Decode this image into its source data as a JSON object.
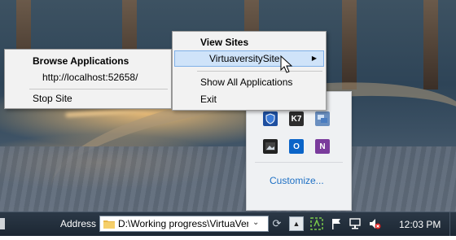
{
  "system_menu": {
    "items": [
      {
        "label": "View Sites",
        "bold": true
      },
      {
        "label": "VirtuaversitySite",
        "has_submenu": true,
        "highlighted": true
      },
      {
        "label": "Show All Applications"
      },
      {
        "label": "Exit"
      }
    ]
  },
  "site_submenu": {
    "header": "Browse Applications",
    "url": "http://localhost:52658/",
    "stop_label": "Stop Site"
  },
  "tray_overflow": {
    "icons": [
      "shield-icon",
      "k7-icon",
      "network-share-icon",
      "photo-icon",
      "outlook-icon",
      "onenote-icon"
    ],
    "customize_label": "Customize..."
  },
  "taskbar": {
    "address_label": "Address",
    "address_value": "D:\\Working progress\\VirtuaVer",
    "time": "12:03 PM"
  },
  "colors": {
    "menu_highlight": "#cfe3f9",
    "link": "#1e70c4",
    "taskbar": "#1c2733"
  }
}
